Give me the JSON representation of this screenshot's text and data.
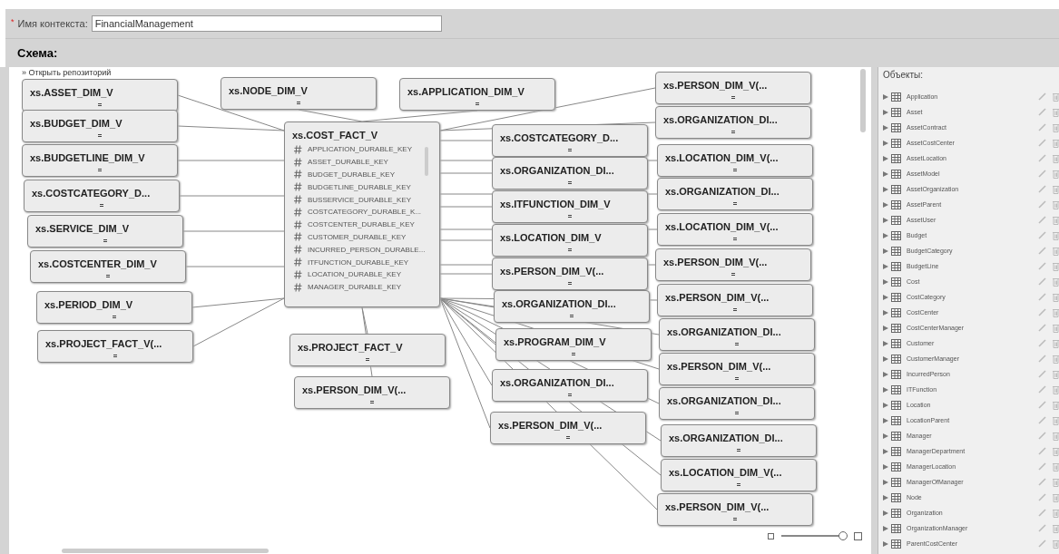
{
  "context": {
    "required_mark": "*",
    "label": "Имя контекста:",
    "value": "FinancialManagement"
  },
  "schema": {
    "title": "Схема:",
    "open_repository": {
      "arrow": "»",
      "label": "Открыть репозиторий"
    }
  },
  "fact_table": {
    "title": "xs.COST_FACT_V",
    "fields": [
      "APPLICATION_DURABLE_KEY",
      "ASSET_DURABLE_KEY",
      "BUDGET_DURABLE_KEY",
      "BUDGETLINE_DURABLE_KEY",
      "BUSSERVICE_DURABLE_KEY",
      "COSTCATEGORY_DURABLE_K...",
      "COSTCENTER_DURABLE_KEY",
      "CUSTOMER_DURABLE_KEY",
      "INCURRED_PERSON_DURABLE...",
      "ITFUNCTION_DURABLE_KEY",
      "LOCATION_DURABLE_KEY",
      "MANAGER_DURABLE_KEY"
    ]
  },
  "tables": [
    {
      "title": "xs.ASSET_DIM_V"
    },
    {
      "title": "xs.NODE_DIM_V"
    },
    {
      "title": "xs.APPLICATION_DIM_V"
    },
    {
      "title": "xs.BUDGET_DIM_V"
    },
    {
      "title": "xs.BUDGETLINE_DIM_V"
    },
    {
      "title": "xs.COSTCATEGORY_D..."
    },
    {
      "title": "xs.SERVICE_DIM_V"
    },
    {
      "title": "xs.COSTCENTER_DIM_V"
    },
    {
      "title": "xs.PERIOD_DIM_V"
    },
    {
      "title": "xs.PROJECT_FACT_V(..."
    },
    {
      "title": "xs.PROJECT_FACT_V"
    },
    {
      "title": "xs.PERSON_DIM_V(..."
    },
    {
      "title": "xs.COSTCATEGORY_D..."
    },
    {
      "title": "xs.ORGANIZATION_DI..."
    },
    {
      "title": "xs.ITFUNCTION_DIM_V"
    },
    {
      "title": "xs.LOCATION_DIM_V"
    },
    {
      "title": "xs.PERSON_DIM_V(..."
    },
    {
      "title": "xs.ORGANIZATION_DI..."
    },
    {
      "title": "xs.PROGRAM_DIM_V"
    },
    {
      "title": "xs.ORGANIZATION_DI..."
    },
    {
      "title": "xs.PERSON_DIM_V(..."
    },
    {
      "title": "xs.PERSON_DIM_V(..."
    },
    {
      "title": "xs.ORGANIZATION_DI..."
    },
    {
      "title": "xs.LOCATION_DIM_V(..."
    },
    {
      "title": "xs.ORGANIZATION_DI..."
    },
    {
      "title": "xs.LOCATION_DIM_V(..."
    },
    {
      "title": "xs.PERSON_DIM_V(..."
    },
    {
      "title": "xs.PERSON_DIM_V(..."
    },
    {
      "title": "xs.ORGANIZATION_DI..."
    },
    {
      "title": "xs.PERSON_DIM_V(..."
    },
    {
      "title": "xs.ORGANIZATION_DI..."
    },
    {
      "title": "xs.ORGANIZATION_DI..."
    },
    {
      "title": "xs.LOCATION_DIM_V(..."
    },
    {
      "title": "xs.PERSON_DIM_V(..."
    }
  ],
  "zoom": {
    "level": 0.95
  },
  "objects": {
    "title": "Объекты:",
    "items": [
      "Application",
      "Asset",
      "AssetContract",
      "AssetCostCenter",
      "AssetLocation",
      "AssetModel",
      "AssetOrganization",
      "AssetParent",
      "AssetUser",
      "Budget",
      "BudgetCategory",
      "BudgetLine",
      "Cost",
      "CostCategory",
      "CostCenter",
      "CostCenterManager",
      "Customer",
      "CustomerManager",
      "IncurredPerson",
      "ITFunction",
      "Location",
      "LocationParent",
      "Manager",
      "ManagerDepartment",
      "ManagerLocation",
      "ManagerOfManager",
      "Node",
      "Organization",
      "OrganizationManager",
      "ParentCostCenter"
    ]
  }
}
